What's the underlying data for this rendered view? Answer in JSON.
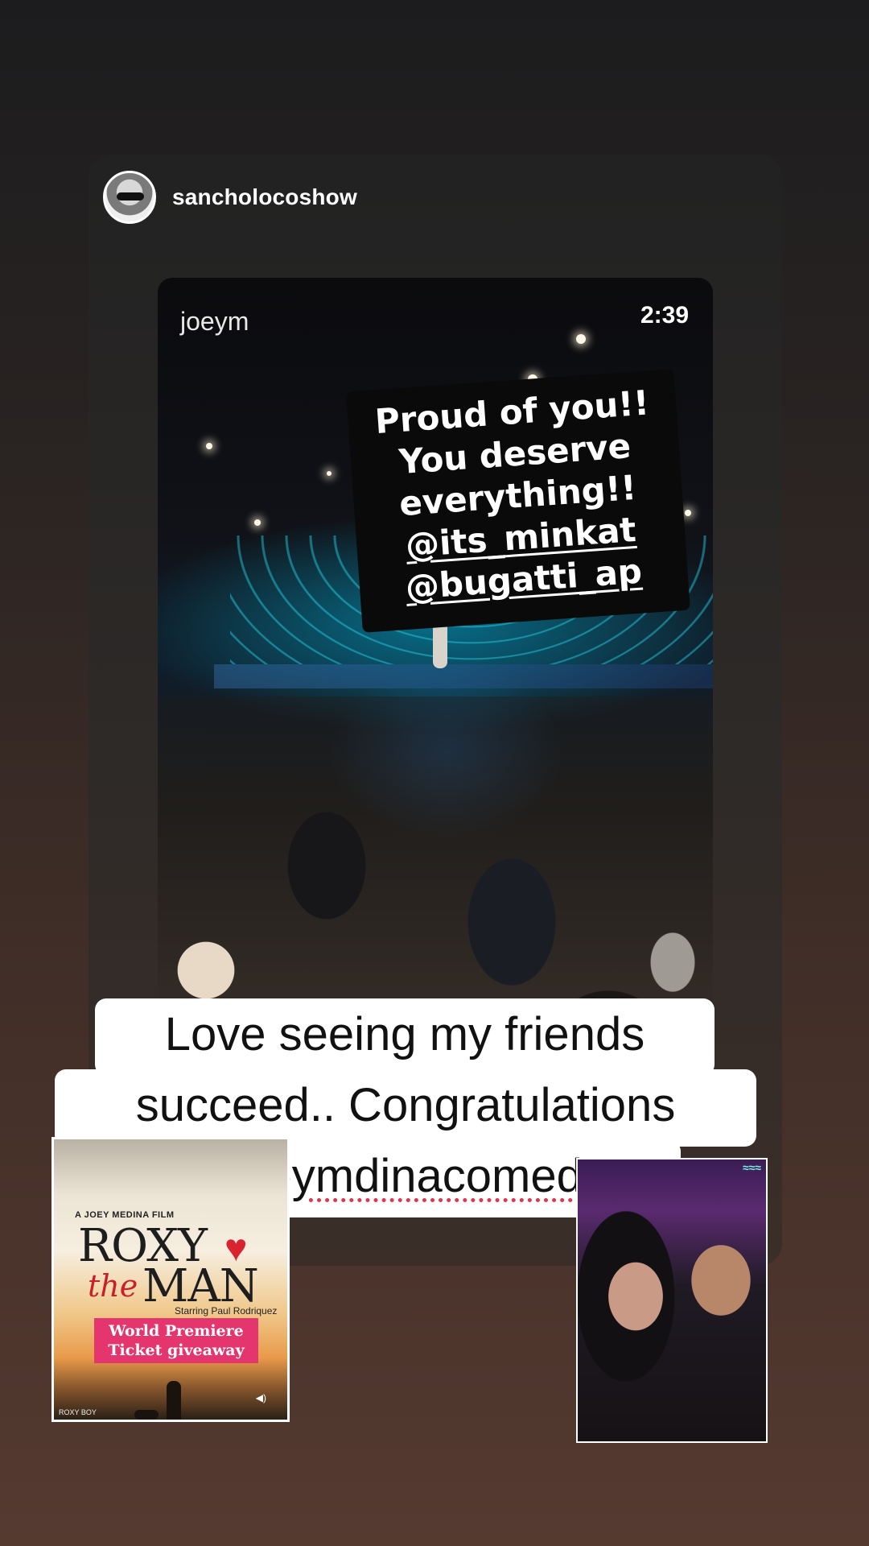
{
  "story": {
    "username": "sancholocoshow",
    "avatar_icon": "user-avatar"
  },
  "video": {
    "username_partial": "joeym",
    "time": "2:39"
  },
  "sticker": {
    "lines": [
      "Proud of you!!",
      "You deserve",
      "everything!!"
    ],
    "mentions": [
      "@its_minkat",
      "@bugatti_ap"
    ]
  },
  "caption": {
    "line1": "Love seeing my friends",
    "line2": "succeed.. Congratulations",
    "line3": "#joeymdinacomedy"
  },
  "poster": {
    "credit": "A JOEY MEDINA FILM",
    "title_roxy": "ROXY",
    "title_the": "the",
    "title_man": "MAN",
    "starring": "Starring Paul Rodriquez",
    "badge_line1": "World Premiere",
    "badge_line2": "Ticket giveaway",
    "footer": "ROXY BOY"
  },
  "colors": {
    "caption_bg": "#ffffff",
    "poster_badge": "#e5356f",
    "hashtag_underline": "#e0354f"
  }
}
